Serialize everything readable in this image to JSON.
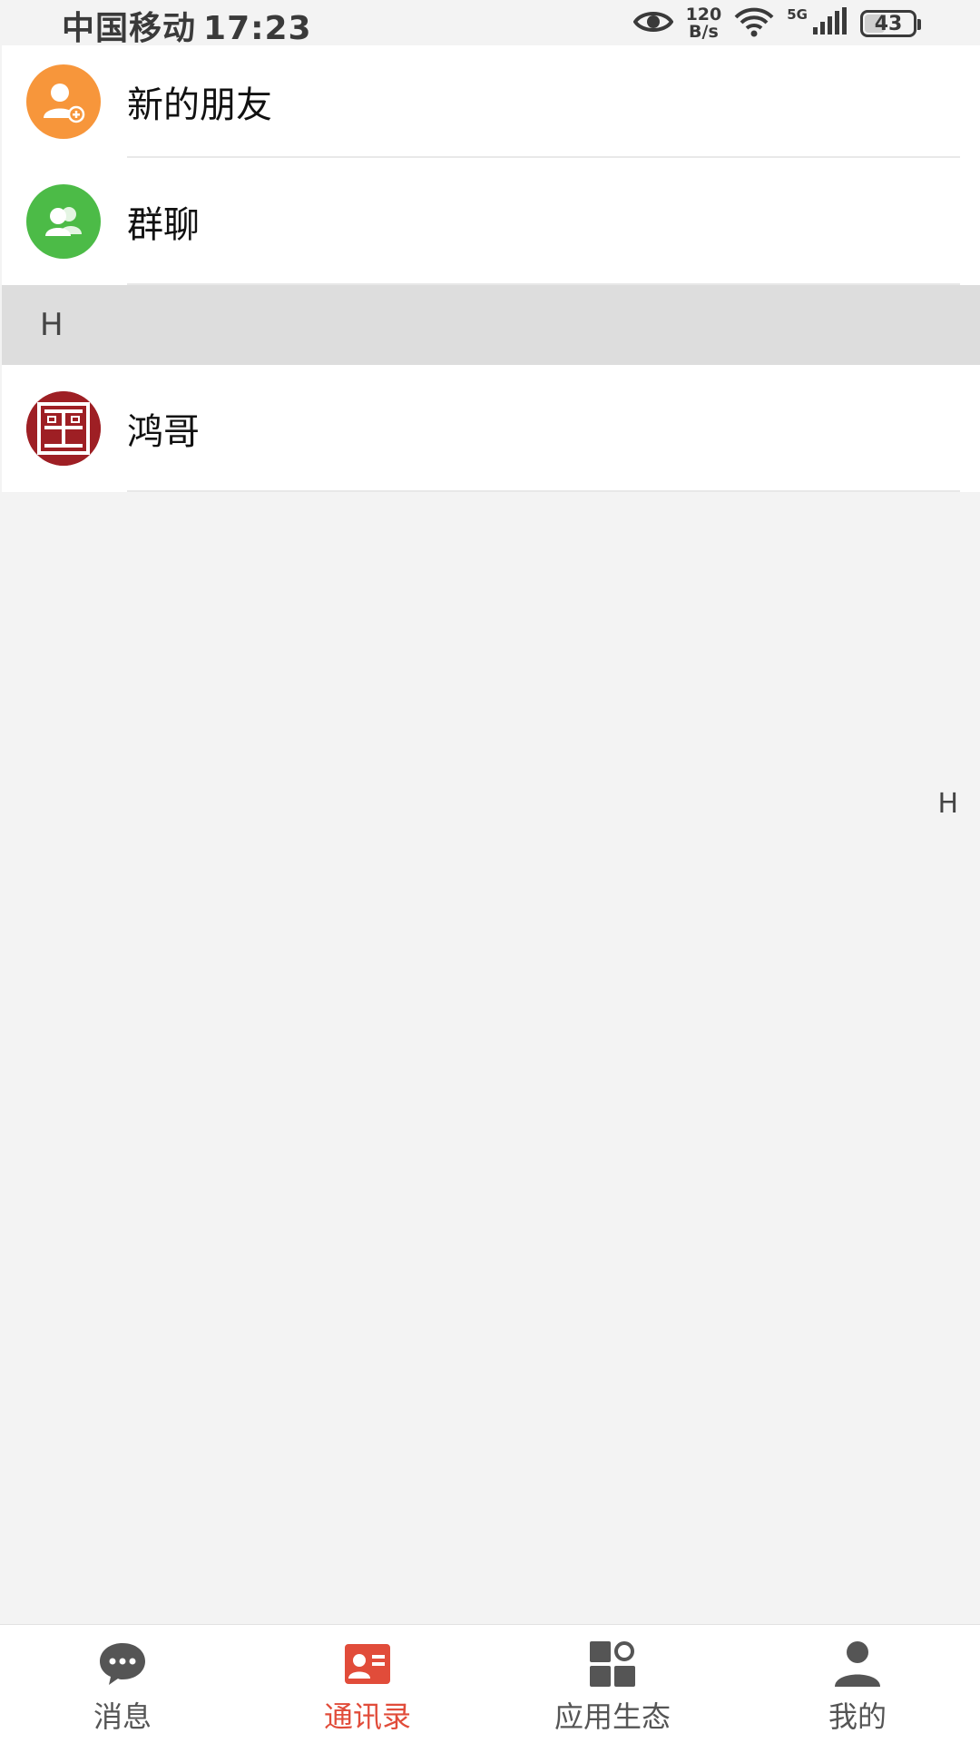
{
  "status_bar": {
    "carrier": "中国移动",
    "time": "17:23",
    "net_speed_value": "120",
    "net_speed_unit": "B/s",
    "network_generation": "5G",
    "battery_level": "43"
  },
  "contacts": {
    "fixed_items": [
      {
        "label": "新的朋友",
        "icon": "add-friend-icon",
        "color": "#f7963b"
      },
      {
        "label": "群聊",
        "icon": "group-chat-icon",
        "color": "#4cbb47"
      }
    ],
    "sections": [
      {
        "letter": "H",
        "items": [
          {
            "label": "鸿哥",
            "icon": "contact-avatar"
          }
        ]
      }
    ]
  },
  "index_bar": {
    "letters": [
      "H"
    ]
  },
  "tab_bar": {
    "active_color": "#e14c3a",
    "inactive_color": "#555555",
    "tabs": [
      {
        "label": "消息",
        "icon": "chat-bubble-icon",
        "active": false
      },
      {
        "label": "通讯录",
        "icon": "contact-card-icon",
        "active": true
      },
      {
        "label": "应用生态",
        "icon": "apps-grid-icon",
        "active": false
      },
      {
        "label": "我的",
        "icon": "person-icon",
        "active": false
      }
    ]
  }
}
